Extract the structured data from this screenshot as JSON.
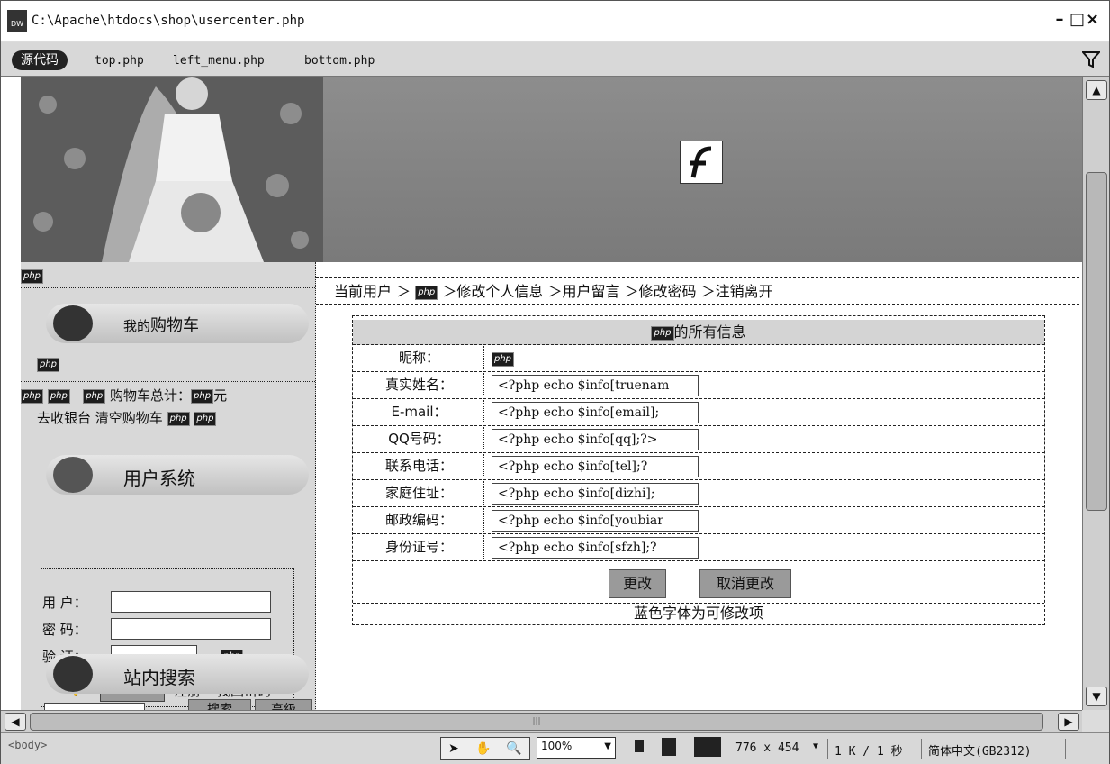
{
  "window": {
    "title": "C:\\Apache\\htdocs\\shop\\usercenter.php",
    "app_icon": "DW",
    "minimize": "–",
    "maximize": "□",
    "close": "×"
  },
  "doc_tabs": {
    "source": "源代码",
    "files": [
      "top.php",
      "left_menu.php",
      "bottom.php"
    ]
  },
  "php_icon": "php",
  "left": {
    "cart_title_a": "我的",
    "cart_title_b": "购物车",
    "cart_total_label": "购物车总计：",
    "yuan": "元",
    "checkout": "去收银台",
    "clear_cart": "清空购物车",
    "user_title": "用户系统",
    "user_label": "用 户：",
    "pwd_label": "密 码：",
    "verify_label": "验 证：",
    "login": "登 录",
    "register": "注册",
    "find_pwd": "找回密码",
    "search_title": "站内搜索",
    "search_btn": "搜索",
    "adv_btn": "高级"
  },
  "breadcrumb": {
    "current": "当前用户 ＞",
    "items": [
      "＞修改个人信息",
      "＞用户留言",
      "＞修改密码",
      "＞注销离开"
    ]
  },
  "info": {
    "header_suffix": "的所有信息",
    "nick_label": "昵称：",
    "rows": [
      {
        "label": "真实姓名：",
        "value": "<?php echo $info[truenam"
      },
      {
        "label": "E-mail：",
        "value": "<?php echo $info[email];"
      },
      {
        "label": "QQ号码：",
        "value": "<?php echo $info[qq];?>"
      },
      {
        "label": "联系电话：",
        "value": "<?php echo $info[tel];?"
      },
      {
        "label": "家庭住址：",
        "value": "<?php echo $info[dizhi];"
      },
      {
        "label": "邮政编码：",
        "value": "<?php echo $info[youbiar"
      },
      {
        "label": "身份证号：",
        "value": "<?php echo $info[sfzh];?"
      }
    ],
    "change_btn": "更改",
    "cancel_btn": "取消更改",
    "note": "蓝色字体为可修改项"
  },
  "status": {
    "tag": "<body>",
    "zoom": "100%",
    "size": "776 x 454",
    "filesize": "1 K / 1 秒",
    "encoding": "简体中文(GB2312)"
  }
}
